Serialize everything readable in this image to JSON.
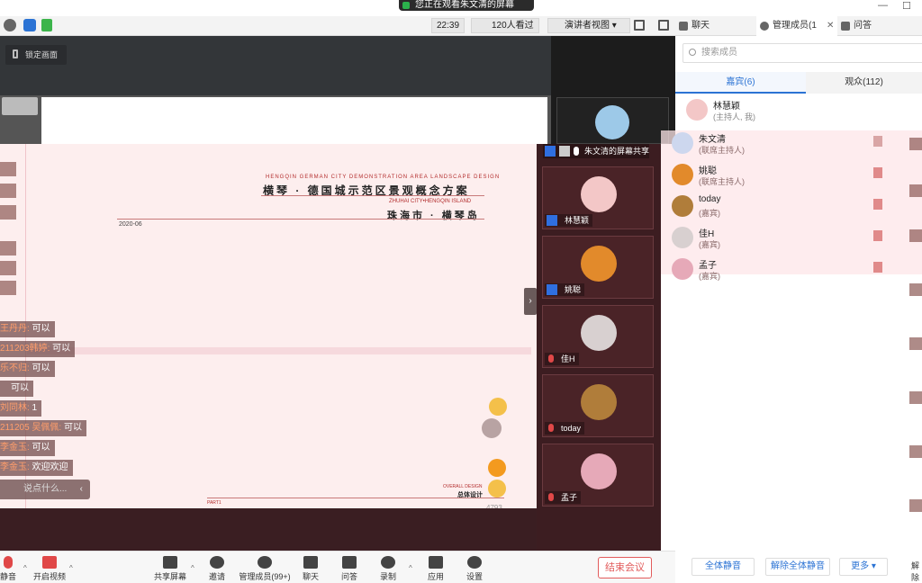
{
  "banner": {
    "text": "您正在观看朱文清的屏幕"
  },
  "toolbar": {
    "time": "22:39",
    "viewers": "120人看过",
    "view_mode": "演讲者视图"
  },
  "tabs": [
    {
      "label": "聊天"
    },
    {
      "label": "管理成员(1"
    },
    {
      "label": "问答"
    }
  ],
  "stage": {
    "lock_label": "锁定画面",
    "share_tile_label": "朱文清的屏幕共享"
  },
  "slide": {
    "eng_title": "HENGQIN GERMAN CITY DEMONSTRATION AREA LANDSCAPE DESIGN",
    "title": "横琴 · 德国城示范区景观概念方案",
    "eng_city": "ZHUHAI CITY•HENGQIN ISLAND",
    "city": "珠海市 · 横琴岛",
    "date": "2020-06",
    "overall_en": "OVERALL DESIGN",
    "overall_cn": "总体设计",
    "part": "PART1",
    "count": "4793"
  },
  "chat": {
    "messages": [
      {
        "who": "王丹丹:",
        "text": " 可以"
      },
      {
        "who": "211203韩婷:",
        "text": " 可以"
      },
      {
        "who": "乐不归:",
        "text": " 可以"
      },
      {
        "who": "",
        "text": "可以"
      },
      {
        "who": "刘同林:",
        "text": " 1"
      },
      {
        "who": "211205 吴佩佩:",
        "text": " 可以"
      },
      {
        "who": "李金玉:",
        "text": " 可以"
      },
      {
        "who": "李金玉:",
        "text": " 欢迎欢迎"
      }
    ],
    "input_placeholder": "说点什么..."
  },
  "tiles": [
    {
      "name": "林慧颖",
      "role": "host"
    },
    {
      "name": "姚聪",
      "role": "cohost"
    },
    {
      "name": "佳H",
      "role": ""
    },
    {
      "name": "today",
      "role": ""
    },
    {
      "name": "孟子",
      "role": ""
    }
  ],
  "panel": {
    "search_placeholder": "搜索成员",
    "seg_guests": "嘉宾(6)",
    "seg_audience": "观众(112)",
    "members": [
      {
        "name": "林慧颖",
        "role": "(主持人, 我)"
      },
      {
        "name": "朱文清",
        "role": "(联席主持人)"
      },
      {
        "name": "姚聪",
        "role": "(联席主持人)"
      },
      {
        "name": "today",
        "role": "(嘉宾)"
      },
      {
        "name": "佳H",
        "role": "(嘉宾)"
      },
      {
        "name": "孟子",
        "role": "(嘉宾)"
      }
    ],
    "mute_all": "全体静音",
    "unmute_all": "解除全体静音",
    "more": "更多",
    "edge_label": "解除"
  },
  "bottom": {
    "mic": "静音",
    "video": "开启视频",
    "share": "共享屏幕",
    "invite": "邀请",
    "members": "管理成员(99+)",
    "chat": "聊天",
    "qa": "问答",
    "record": "录制",
    "apps": "应用",
    "settings": "设置",
    "end": "结束会议"
  },
  "colors": {
    "accent": "#2b73d4",
    "danger": "#e25b5b",
    "slide_bg": "#fdeeee",
    "tiles_bg": "#3c1d21"
  }
}
